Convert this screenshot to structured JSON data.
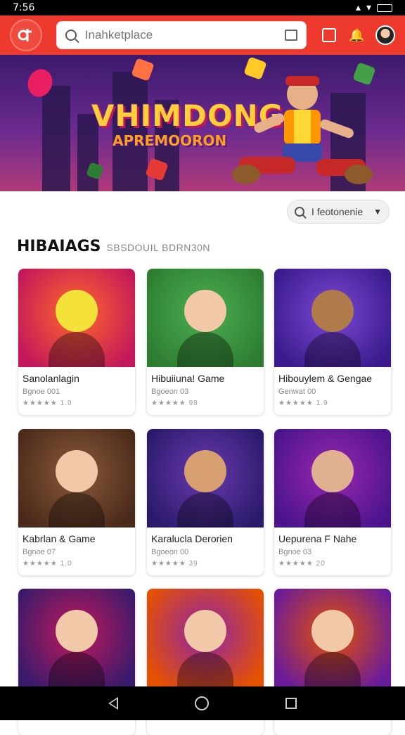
{
  "status": {
    "time": "7:56"
  },
  "search": {
    "placeholder": "Inahketplace"
  },
  "banner": {
    "title": "VHIMDONG",
    "subtitle": "APREMOORON"
  },
  "filter": {
    "label": "I feotonenie"
  },
  "section": {
    "title": "HIBAIAGS",
    "subtitle": "SBSDOUIL BDRN30N"
  },
  "games": [
    {
      "name": "Sanolanlagin",
      "meta": "Bgnoe 001",
      "rating": "★★★★★ 1.0",
      "theme": [
        "#ff6a2a",
        "#c2185b"
      ],
      "face": "#f4e23a"
    },
    {
      "name": "Hibuiiuna! Game",
      "meta": "Bgoeon 03",
      "rating": "★★★★★ 98",
      "theme": [
        "#4caf50",
        "#2e7d32"
      ],
      "face": "#f1c8a8"
    },
    {
      "name": "Hibouylem & Gengae",
      "meta": "Genwat 00",
      "rating": "★★★★★ 1.9",
      "theme": [
        "#7b4ad6",
        "#3a1a8c"
      ],
      "face": "#b07a4a"
    },
    {
      "name": "Kabrlan & Game",
      "meta": "Bgnoe 07",
      "rating": "★★★★★ 1.0",
      "theme": [
        "#8b5a3a",
        "#4a2a1a"
      ],
      "face": "#f1c8a8"
    },
    {
      "name": "Karalucla Derorien",
      "meta": "Bgoeon 00",
      "rating": "★★★★★ 39",
      "theme": [
        "#6a3ab0",
        "#2b1a6b"
      ],
      "face": "#d8a070"
    },
    {
      "name": "Uepurena F Nahe",
      "meta": "Bgnoe 03",
      "rating": "★★★★★ 20",
      "theme": [
        "#9c27b0",
        "#4a148c"
      ],
      "face": "#e0b090"
    },
    {
      "name": "",
      "meta": "",
      "rating": "",
      "theme": [
        "#c2185b",
        "#3a1a6b"
      ],
      "face": "#f1c8a8"
    },
    {
      "name": "",
      "meta": "",
      "rating": "",
      "theme": [
        "#8e24aa",
        "#e65100"
      ],
      "face": "#f1c8a8"
    },
    {
      "name": "",
      "meta": "",
      "rating": "",
      "theme": [
        "#e65100",
        "#6a1b9a"
      ],
      "face": "#f1c8a8"
    }
  ],
  "colors": {
    "accent": "#ee3a2e"
  }
}
